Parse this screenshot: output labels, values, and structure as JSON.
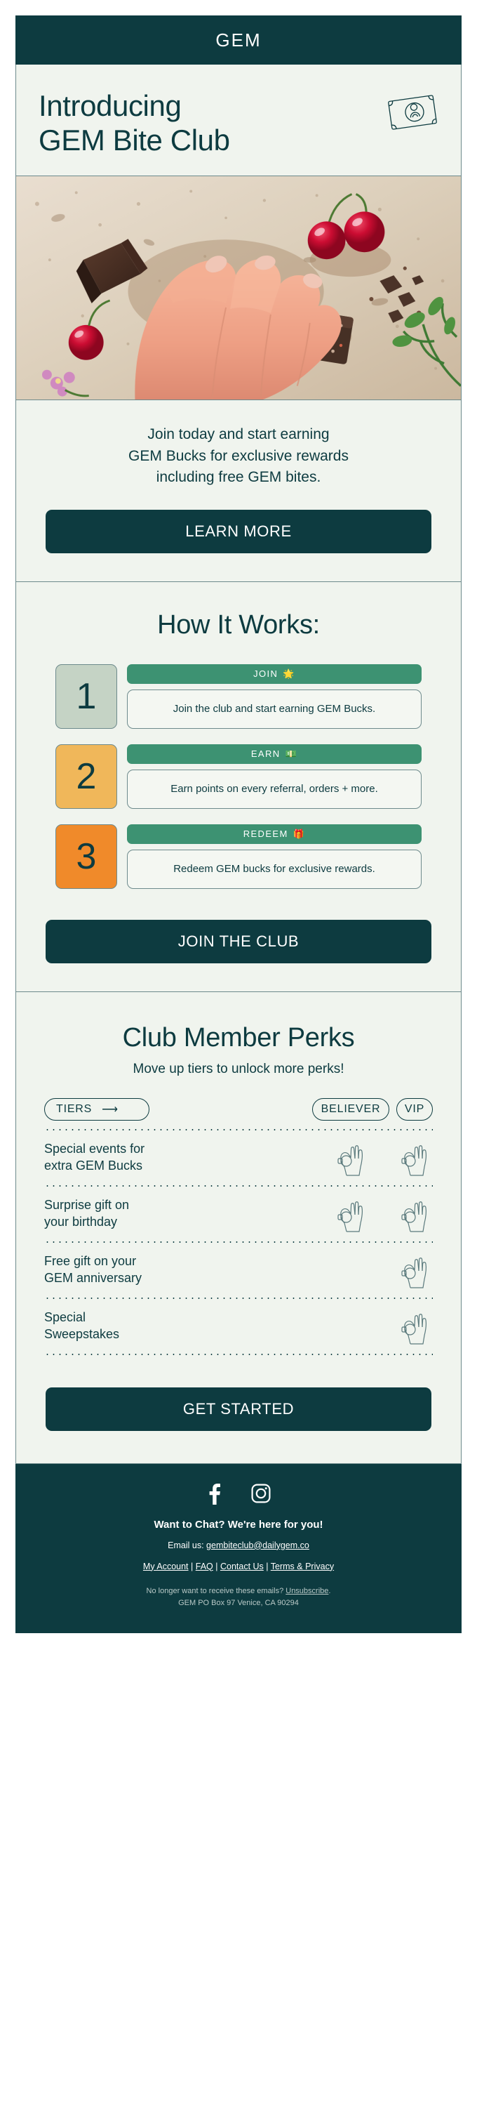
{
  "brand": {
    "logo_text": "GEM"
  },
  "hero": {
    "title_line1": "Introducing",
    "title_line2": "GEM Bite Club",
    "money_icon": "banknote-icon",
    "photo_alt": "hand-with-chocolate-bites-photo",
    "body_line1": "Join today and start earning",
    "body_line2": "GEM Bucks for exclusive rewards",
    "body_line3": "including free GEM bites.",
    "cta_label": "LEARN MORE"
  },
  "how_it_works": {
    "title": "How It Works:",
    "steps": [
      {
        "number": "1",
        "tag": "JOIN",
        "tag_emoji": "🌟",
        "description": "Join the club and start earning GEM Bucks.",
        "box_color": "#c5d3c5"
      },
      {
        "number": "2",
        "tag": "EARN",
        "tag_emoji": "💵",
        "description": "Earn points on every referral, orders + more.",
        "box_color": "#f0b75a"
      },
      {
        "number": "3",
        "tag": "REDEEM",
        "tag_emoji": "🎁",
        "description": "Redeem GEM bucks for exclusive rewards.",
        "box_color": "#f08a2a"
      }
    ],
    "cta_label": "JOIN THE CLUB"
  },
  "perks": {
    "title": "Club Member Perks",
    "subtitle": "Move up tiers to unlock more perks!",
    "tier_label": "TIERS",
    "tier_arrow": "⟶",
    "columns": [
      "BELIEVER",
      "VIP"
    ],
    "rows": [
      {
        "label": "Special events for\nextra GEM Bucks",
        "believer": true,
        "vip": true
      },
      {
        "label": "Surprise gift on\nyour birthday",
        "believer": true,
        "vip": true
      },
      {
        "label": "Free gift on your\nGEM anniversary",
        "believer": false,
        "vip": true
      },
      {
        "label": "Special\nSweepstakes",
        "believer": false,
        "vip": true
      }
    ],
    "check_icon": "ok-hand-icon",
    "cta_label": "GET STARTED"
  },
  "footer": {
    "social": [
      {
        "name": "facebook-icon",
        "label": "Facebook"
      },
      {
        "name": "instagram-icon",
        "label": "Instagram"
      }
    ],
    "heading": "Want to Chat? We're here for you!",
    "email_prefix": "Email us: ",
    "email": "gembiteclub@dailygem.co",
    "links": [
      "My Account",
      "FAQ",
      "Contact Us",
      "Terms & Privacy"
    ],
    "link_separator": " | ",
    "unsub_prefix": "No longer want to receive these emails? ",
    "unsub_label": "Unsubscribe",
    "unsub_suffix": ".",
    "address": "GEM PO Box 97 Venice, CA 90294"
  },
  "colors": {
    "dark_teal": "#0d3b40",
    "cream": "#f0f4ee",
    "green_tag": "#3d9272",
    "sage": "#c5d3c5",
    "amber": "#f0b75a",
    "orange": "#f08a2a"
  }
}
